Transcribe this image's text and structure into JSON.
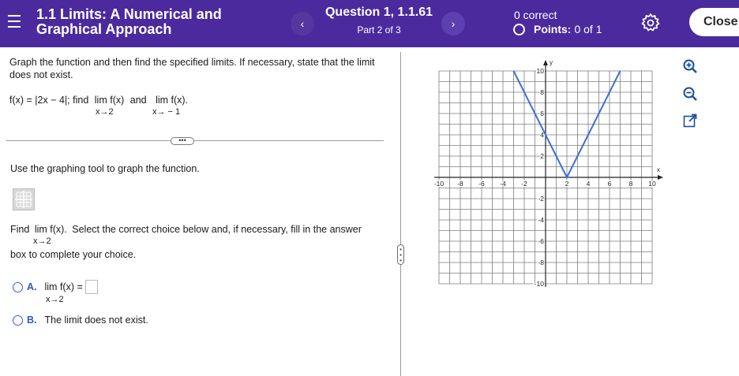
{
  "header": {
    "menu_icon": "hamburger-icon",
    "section_title": "1.1 Limits: A Numerical and Graphical Approach",
    "prev_label": "‹",
    "next_label": "›",
    "question_title": "Question 1, 1.1.61",
    "question_part": "Part 2 of 3",
    "correct_text": "0 correct",
    "points_label": "Points:",
    "points_value": "0 of 1",
    "settings_icon": "gear-icon",
    "close_label": "Close",
    "accent": "#4b2a9e"
  },
  "problem": {
    "prompt": "Graph the function and then find the specified limits. If necessary, state that the limit does not exist.",
    "fx_text": "f(x) = |2x − 4|; find",
    "lim1": "lim f(x)",
    "lim1_sub": "x→2",
    "and_text": "and",
    "lim2": "lim f(x).",
    "lim2_sub": "x→ − 1",
    "more_label": "•••",
    "instruction": "Use the graphing tool to graph the function.",
    "graph_tool_icon": "graphing-tool-icon",
    "find_prefix": "Find",
    "find_lim": "lim f(x).",
    "find_lim_sub": "x→2",
    "find_rest": "Select the correct choice below and, if necessary, fill in the answer",
    "box_line": "box to complete your choice."
  },
  "choices": [
    {
      "letter": "A.",
      "lim": "lim f(x) =",
      "sub": "x→2",
      "answer": ""
    },
    {
      "letter": "B.",
      "text": "The limit does not exist."
    }
  ],
  "graph": {
    "x_label": "x",
    "y_label": "y",
    "x_ticks": [
      "-10",
      "-8",
      "-6",
      "-4",
      "-2",
      "2",
      "4",
      "6",
      "8",
      "10"
    ],
    "y_ticks": [
      "10",
      "8",
      "6",
      "4",
      "2",
      "-2",
      "-4",
      "-6",
      "-8",
      "-10"
    ],
    "xlim": [
      -10,
      10
    ],
    "ylim": [
      -10,
      10
    ],
    "line_color": "#3f6fd1",
    "points": [
      [
        -3,
        10
      ],
      [
        2,
        0
      ],
      [
        7,
        10
      ]
    ]
  },
  "tools": {
    "zoom_in_icon": "zoom-in-icon",
    "zoom_out_icon": "zoom-out-icon",
    "popout_icon": "pop-out-icon"
  }
}
